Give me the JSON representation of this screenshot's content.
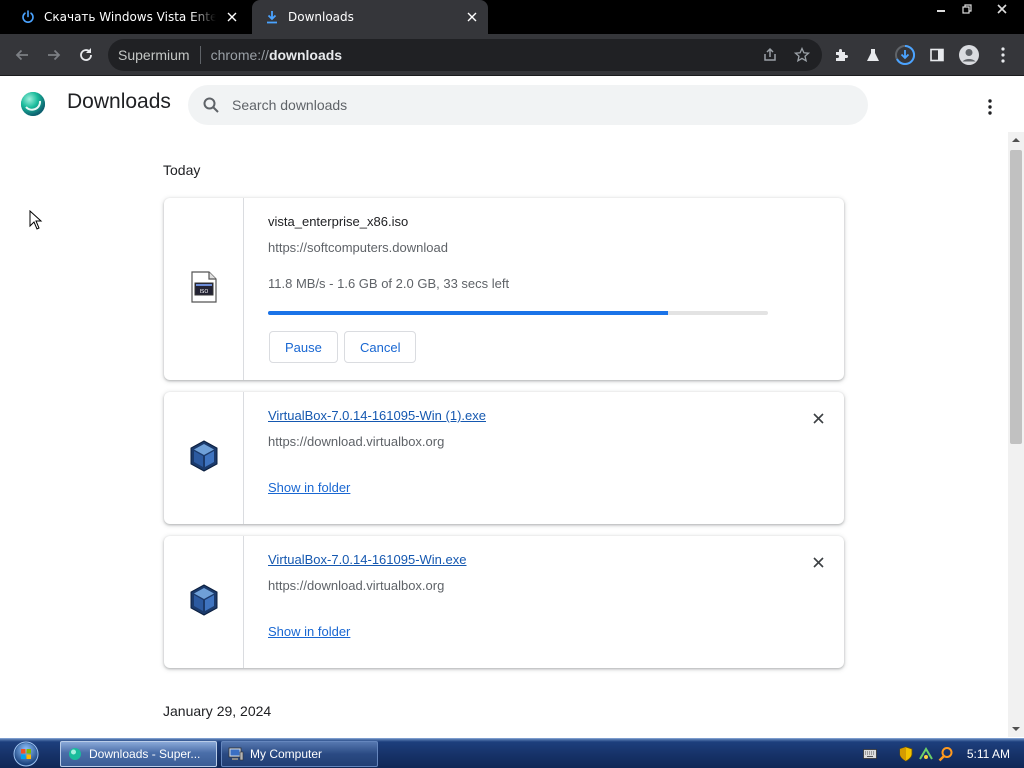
{
  "browser": {
    "tabs": [
      {
        "title": "Скачать Windows Vista Enterprise",
        "active": false
      },
      {
        "title": "Downloads",
        "active": true
      }
    ],
    "omnibox": {
      "site_label": "Supermium",
      "url_prefix": "chrome://",
      "url_host": "downloads"
    }
  },
  "page": {
    "title": "Downloads",
    "search_placeholder": "Search downloads"
  },
  "groups": [
    {
      "date": "Today",
      "items": [
        {
          "filename": "vista_enterprise_x86.iso",
          "url": "https://softcomputers.download",
          "status": "11.8 MB/s - 1.6 GB of 2.0 GB, 33 secs left",
          "progress": 0.8,
          "actions": {
            "pause": "Pause",
            "cancel": "Cancel"
          }
        },
        {
          "filename": "VirtualBox-7.0.14-161095-Win (1).exe",
          "url": "https://download.virtualbox.org",
          "action": "Show in folder"
        },
        {
          "filename": "VirtualBox-7.0.14-161095-Win.exe",
          "url": "https://download.virtualbox.org",
          "action": "Show in folder"
        }
      ]
    },
    {
      "date": "January 29, 2024",
      "items": []
    }
  ],
  "taskbar": {
    "buttons": [
      {
        "label": "Downloads - Super...",
        "active": true
      },
      {
        "label": "My Computer",
        "active": false
      }
    ],
    "clock": "5:11 AM"
  },
  "colors": {
    "accent": "#1a73e8",
    "toolbar": "#35363a",
    "tabstrip": "#000000",
    "taskbar": "#17336a"
  }
}
